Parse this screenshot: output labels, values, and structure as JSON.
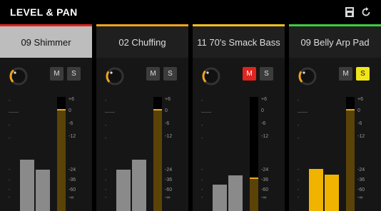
{
  "panel": {
    "title": "LEVEL & PAN"
  },
  "icons": {
    "save": "save-icon",
    "refresh": "refresh-icon"
  },
  "scale_labels": [
    "+6",
    "0",
    "-6",
    "-12",
    "-24",
    "-36",
    "-60",
    "-∞"
  ],
  "mute_label": "M",
  "solo_label": "S",
  "colors": {
    "background": "#000000",
    "panel": "#1b1b1b",
    "selected_header": "#bdbdbd",
    "knob_accent": "#f0a31c",
    "bar_inactive": "#8a8a8a",
    "bar_active": "#f0b400",
    "fader_fill": "#5b4308",
    "mute_on": "#e0241f",
    "solo_on": "#f0e51a"
  },
  "channels": [
    {
      "name": "09 Shimmer",
      "color": "#e0241f",
      "selected": true,
      "mute": false,
      "solo": false,
      "knob_level": 0.35,
      "fader_level": 0.88,
      "meter_levels": [
        0.45,
        0.36
      ],
      "meter_active": false
    },
    {
      "name": "02 Chuffing",
      "color": "#f0a31c",
      "selected": false,
      "mute": false,
      "solo": false,
      "knob_level": 0.3,
      "fader_level": 0.88,
      "meter_levels": [
        0.36,
        0.45
      ],
      "meter_active": false
    },
    {
      "name": "11 70's Smack Bass",
      "color": "#f0c020",
      "selected": false,
      "mute": true,
      "solo": false,
      "knob_level": 0.32,
      "fader_level": 0.28,
      "meter_levels": [
        0.23,
        0.31
      ],
      "meter_active": false
    },
    {
      "name": "09 Belly Arp Pad",
      "color": "#3ccf3c",
      "selected": false,
      "mute": false,
      "solo": true,
      "knob_level": 0.3,
      "fader_level": 0.88,
      "meter_levels": [
        0.37,
        0.32
      ],
      "meter_active": true
    }
  ]
}
